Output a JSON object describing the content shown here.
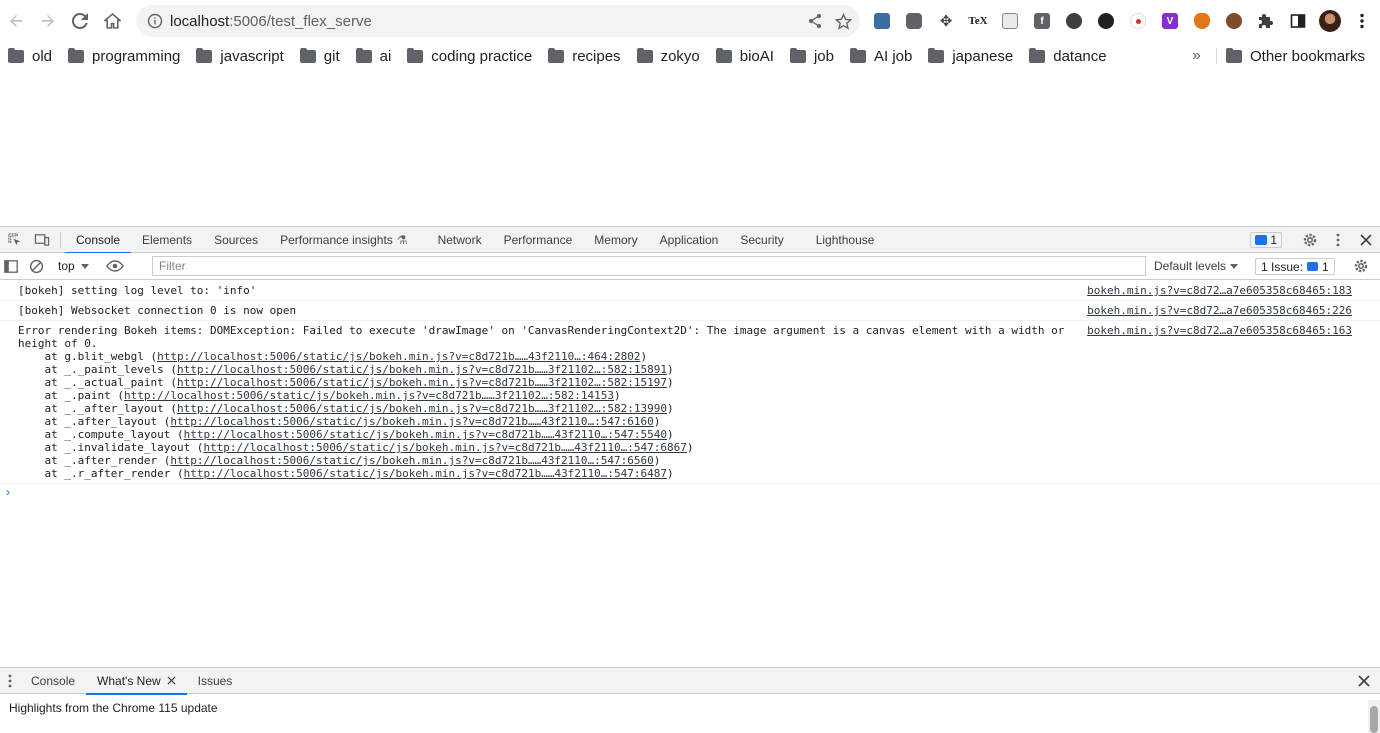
{
  "browser": {
    "url_host": "localhost",
    "url_rest": ":5006/test_flex_serve"
  },
  "bookmarks": [
    "old",
    "programming",
    "javascript",
    "git",
    "ai",
    "coding practice",
    "recipes",
    "zokyo",
    "bioAI",
    "job",
    "AI job",
    "japanese",
    "datance"
  ],
  "bookmarks_more": "»",
  "bookmarks_other": "Other bookmarks",
  "devtools": {
    "tabs": [
      "Console",
      "Elements",
      "Sources",
      "Performance insights",
      "Network",
      "Performance",
      "Memory",
      "Application",
      "Security",
      "Lighthouse"
    ],
    "message_badge_count": "1",
    "context": "top",
    "filter_placeholder": "Filter",
    "levels": "Default levels",
    "issues_label": "1 Issue:",
    "issues_count": "1"
  },
  "console": {
    "messages": [
      {
        "text": "[bokeh] setting log level to: 'info'",
        "source": "bokeh.min.js?v=c8d72…a7e605358c68465:183"
      },
      {
        "text": "[bokeh] Websocket connection 0 is now open",
        "source": "bokeh.min.js?v=c8d72…a7e605358c68465:226"
      }
    ],
    "error": {
      "text1": "Error rendering Bokeh items: DOMException: Failed to execute 'drawImage' on 'CanvasRenderingContext2D': The image argument is a canvas element with a width or",
      "text2": "height of 0.",
      "source": "bokeh.min.js?v=c8d72…a7e605358c68465:163",
      "stack": [
        {
          "fn": "    at g.blit_webgl (",
          "link": "http://localhost:5006/static/js/bokeh.min.js?v=c8d721b……43f2110…:464:2802",
          "end": ")"
        },
        {
          "fn": "    at _._paint_levels (",
          "link": "http://localhost:5006/static/js/bokeh.min.js?v=c8d721b……3f21102…:582:15891",
          "end": ")"
        },
        {
          "fn": "    at _._actual_paint (",
          "link": "http://localhost:5006/static/js/bokeh.min.js?v=c8d721b……3f21102…:582:15197",
          "end": ")"
        },
        {
          "fn": "    at _.paint (",
          "link": "http://localhost:5006/static/js/bokeh.min.js?v=c8d721b……3f21102…:582:14153",
          "end": ")"
        },
        {
          "fn": "    at _._after_layout (",
          "link": "http://localhost:5006/static/js/bokeh.min.js?v=c8d721b……3f21102…:582:13990",
          "end": ")"
        },
        {
          "fn": "    at _.after_layout (",
          "link": "http://localhost:5006/static/js/bokeh.min.js?v=c8d721b……43f2110…:547:6160",
          "end": ")"
        },
        {
          "fn": "    at _.compute_layout (",
          "link": "http://localhost:5006/static/js/bokeh.min.js?v=c8d721b……43f2110…:547:5540",
          "end": ")"
        },
        {
          "fn": "    at _.invalidate_layout (",
          "link": "http://localhost:5006/static/js/bokeh.min.js?v=c8d721b……43f2110…:547:6867",
          "end": ")"
        },
        {
          "fn": "    at _.after_render (",
          "link": "http://localhost:5006/static/js/bokeh.min.js?v=c8d721b……43f2110…:547:6560",
          "end": ")"
        },
        {
          "fn": "    at _.r_after_render (",
          "link": "http://localhost:5006/static/js/bokeh.min.js?v=c8d721b……43f2110…:547:6487",
          "end": ")"
        }
      ]
    },
    "prompt": "›"
  },
  "drawer": {
    "tabs": [
      "Console",
      "What's New",
      "Issues"
    ],
    "highlights": "Highlights from the Chrome 115 update"
  }
}
